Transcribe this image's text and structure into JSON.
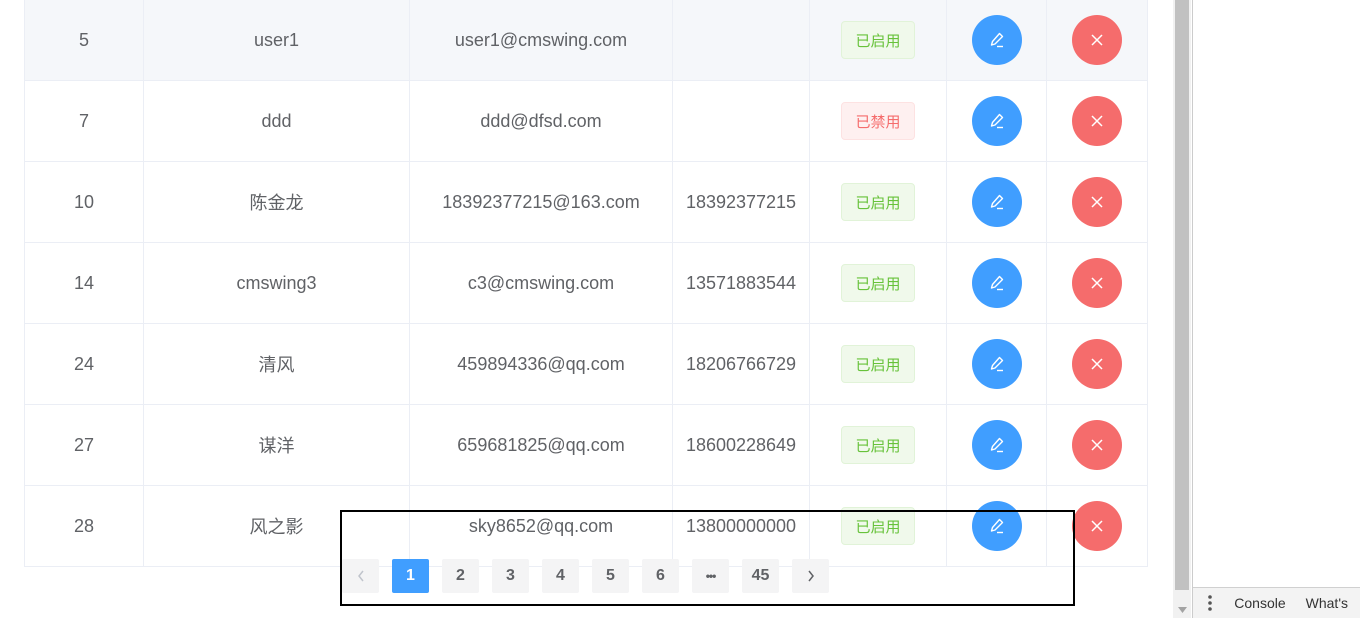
{
  "table": {
    "rows": [
      {
        "id": "5",
        "name": "user1",
        "email": "user1@cmswing.com",
        "phone": "",
        "status": "已启用",
        "status_kind": "on"
      },
      {
        "id": "7",
        "name": "ddd",
        "email": "ddd@dfsd.com",
        "phone": "",
        "status": "已禁用",
        "status_kind": "off"
      },
      {
        "id": "10",
        "name": "陈金龙",
        "email": "18392377215@163.com",
        "phone": "18392377215",
        "status": "已启用",
        "status_kind": "on"
      },
      {
        "id": "14",
        "name": "cmswing3",
        "email": "c3@cmswing.com",
        "phone": "13571883544",
        "status": "已启用",
        "status_kind": "on"
      },
      {
        "id": "24",
        "name": "清风",
        "email": "459894336@qq.com",
        "phone": "18206766729",
        "status": "已启用",
        "status_kind": "on"
      },
      {
        "id": "27",
        "name": "谋洋",
        "email": "659681825@qq.com",
        "phone": "18600228649",
        "status": "已启用",
        "status_kind": "on"
      },
      {
        "id": "28",
        "name": "风之影",
        "email": "sky8652@qq.com",
        "phone": "13800000000",
        "status": "已启用",
        "status_kind": "on"
      }
    ],
    "edit_icon": "edit-icon",
    "delete_icon": "close-icon"
  },
  "pagination": {
    "prev_icon": "chevron-left-icon",
    "next_icon": "chevron-right-icon",
    "pages": [
      "1",
      "2",
      "3",
      "4",
      "5",
      "6"
    ],
    "ellipsis": "•••",
    "last": "45",
    "current": "1"
  },
  "devtools": {
    "menu_icon": "kebab-menu-icon",
    "tabs": [
      "Console",
      "What's"
    ]
  },
  "colors": {
    "primary": "#409eff",
    "danger": "#f56c6c",
    "success": "#67c23a",
    "row_hover": "#f5f7fa"
  }
}
